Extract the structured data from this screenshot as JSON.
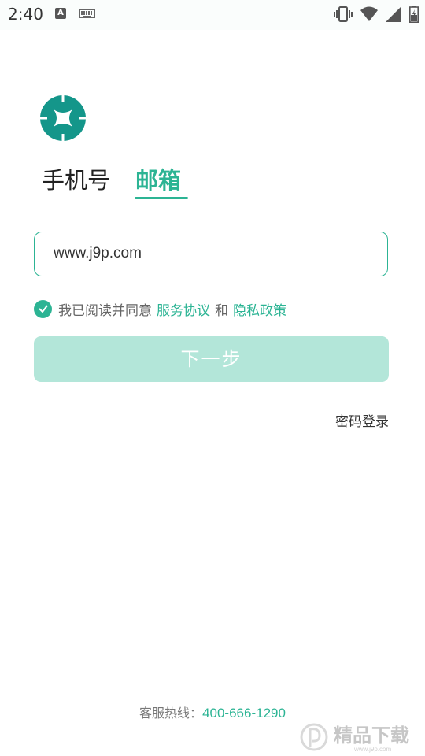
{
  "status_bar": {
    "time": "2:40",
    "left_icons": [
      "font-a-icon",
      "keyboard-icon"
    ],
    "right_icons": [
      "vibrate-icon",
      "wifi-icon",
      "signal-icon",
      "battery-icon"
    ]
  },
  "login": {
    "logo": "app-logo",
    "tabs": [
      {
        "label": "手机号",
        "active": false
      },
      {
        "label": "邮箱",
        "active": true
      }
    ],
    "email_input": {
      "value": "www.j9p.com"
    },
    "agreement": {
      "checked": true,
      "prefix": "我已阅读并同意",
      "terms_link": "服务协议",
      "and_text": "和",
      "privacy_link": "隐私政策"
    },
    "next_button": "下一步",
    "password_login": "密码登录",
    "hotline_label": "客服热线：",
    "hotline_number": "400-666-1290"
  },
  "watermark": {
    "text": "精品下载",
    "url_text": "www.j9p.com"
  },
  "colors": {
    "accent": "#2cb494",
    "button_disabled": "#b3e6d9",
    "text_primary": "#222222",
    "text_secondary": "#666666"
  }
}
